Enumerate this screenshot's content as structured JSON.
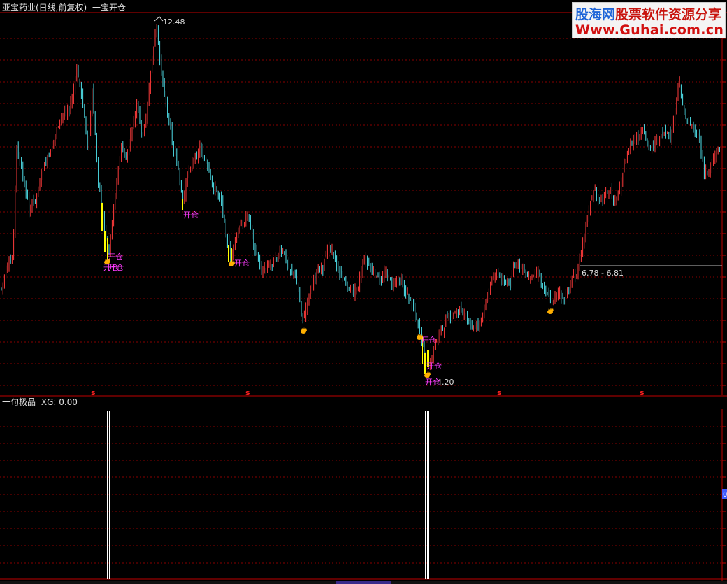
{
  "header": {
    "title_prefix": "亚宝药业(日线,前复权)",
    "indicator_name": "一宝开仓"
  },
  "price_chart": {
    "high_label": "12.48",
    "low_label": "4.20",
    "range_label": "6.78 - 6.81",
    "signal_label": "开仓",
    "dividend_marker": "s",
    "colors": {
      "up": "#ff3b3b",
      "down": "#4fe0ea",
      "signal": "#ff3cff",
      "bar": "#ffff00",
      "coin": "#ffb000",
      "grid": "#8a0000",
      "axis": "#c00000"
    }
  },
  "sub_chart": {
    "title_name": "一句极品",
    "title_value": "XG: 0.00",
    "right_axis_label": "0",
    "colors": {
      "stick": "#ffffff",
      "axis_label_bg": "#3f5bff"
    }
  },
  "watermark": {
    "logo_part1": "股海网",
    "logo_part2": "股票软件资源分享",
    "url": "Www.Guhai.com.cn"
  }
}
